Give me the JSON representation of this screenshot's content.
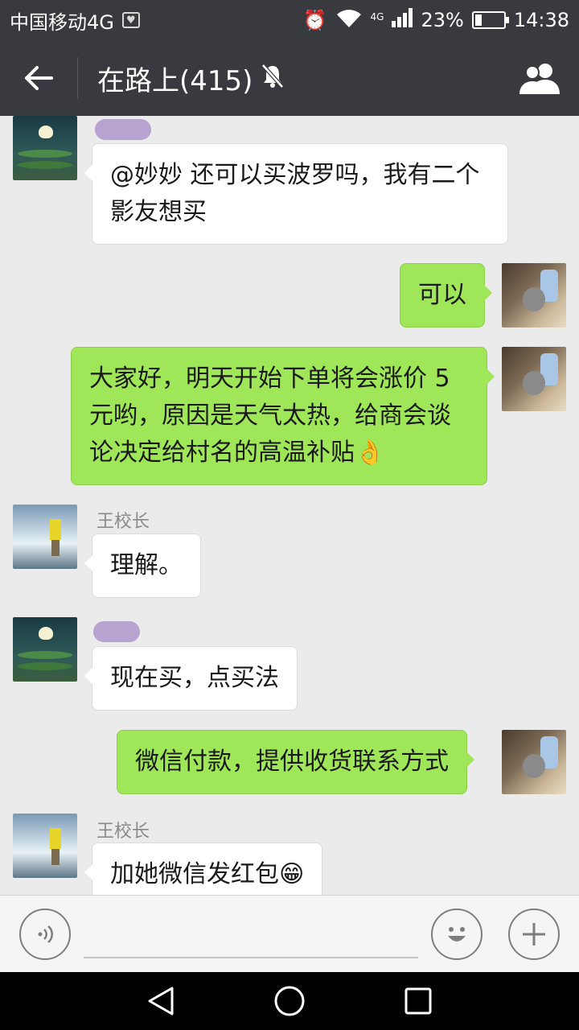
{
  "status_bar": {
    "carrier": "中国移动4G",
    "network_tag": "4G",
    "battery": "23%",
    "battery_level": 0.23,
    "time": "14:38"
  },
  "header": {
    "title": "在路上(415)",
    "back_icon": "arrow-left-icon",
    "mute_icon": "bell-off-icon",
    "members_icon": "group-icon"
  },
  "messages": [
    {
      "side": "in",
      "sender": "",
      "avatar": "lotus",
      "text": "@妙妙  还可以买波罗吗，我有二个影友想买"
    },
    {
      "side": "out",
      "sender": "",
      "avatar": "room",
      "text": "可以"
    },
    {
      "side": "out",
      "sender": "",
      "avatar": "room",
      "text": "大家好，明天开始下单将会涨价 5 元哟，原因是天气太热，给商会谈论决定给村名的高温补贴",
      "emoji": "👌"
    },
    {
      "side": "in",
      "sender": "王校长",
      "avatar": "water",
      "text": "理解。"
    },
    {
      "side": "in",
      "sender": "",
      "avatar": "lotus",
      "text": "现在买，点买法"
    },
    {
      "side": "out",
      "sender": "",
      "avatar": "room",
      "text": "微信付款，提供收货联系方式"
    },
    {
      "side": "in",
      "sender": "王校长",
      "avatar": "water",
      "text": "加她微信发红包",
      "emoji": "😁"
    }
  ],
  "input_bar": {
    "voice_icon": "voice-icon",
    "emoji_icon": "emoji-face-icon",
    "plus_icon": "plus-icon",
    "text_value": ""
  },
  "colors": {
    "header_bg": "#393a3f",
    "chat_bg": "#ebebeb",
    "outgoing_bubble": "#9fe658",
    "incoming_bubble": "#ffffff"
  }
}
